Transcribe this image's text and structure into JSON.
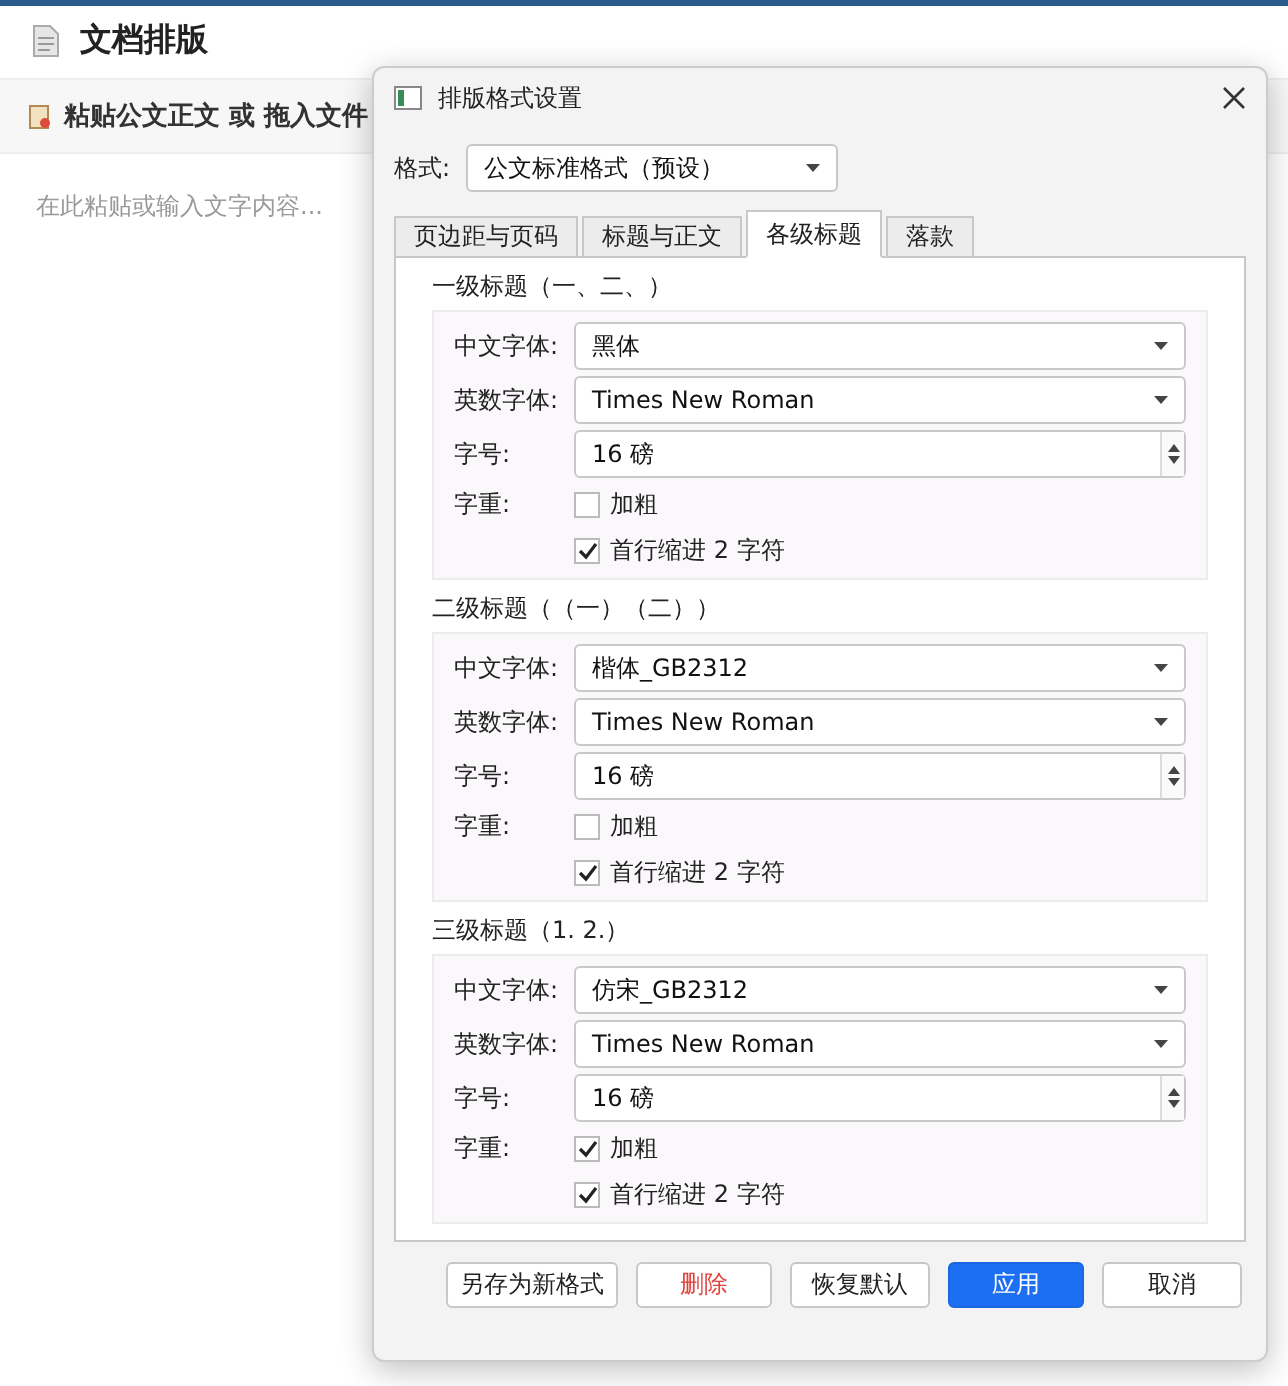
{
  "app": {
    "title": "文档排版",
    "toolbar_label": "粘贴公文正文 或 拖入文件",
    "editor": {
      "placeholder": "在此粘贴或输入文字内容..."
    }
  },
  "dialog": {
    "title": "排版格式设置",
    "format": {
      "label": "格式:",
      "value": "公文标准格式（预设）"
    },
    "tabs": [
      {
        "label": "页边距与页码",
        "selected": false
      },
      {
        "label": "标题与正文",
        "selected": false
      },
      {
        "label": "各级标题",
        "selected": true
      },
      {
        "label": "落款",
        "selected": false
      }
    ],
    "sections": [
      {
        "heading": "一级标题（一、二、）",
        "chinese_font": {
          "label": "中文字体:",
          "value": "黑体"
        },
        "english_font": {
          "label": "英数字体:",
          "value": "Times New Roman"
        },
        "size": {
          "label": "字号:",
          "value": "16 磅"
        },
        "weight_label": "字重:",
        "bold": {
          "label": "加粗",
          "checked": false
        },
        "indent": {
          "label": "首行缩进 2 字符",
          "checked": true
        }
      },
      {
        "heading": "二级标题（（一）（二））",
        "chinese_font": {
          "label": "中文字体:",
          "value": "楷体_GB2312"
        },
        "english_font": {
          "label": "英数字体:",
          "value": "Times New Roman"
        },
        "size": {
          "label": "字号:",
          "value": "16 磅"
        },
        "weight_label": "字重:",
        "bold": {
          "label": "加粗",
          "checked": false
        },
        "indent": {
          "label": "首行缩进 2 字符",
          "checked": true
        }
      },
      {
        "heading": "三级标题（1. 2.）",
        "chinese_font": {
          "label": "中文字体:",
          "value": "仿宋_GB2312"
        },
        "english_font": {
          "label": "英数字体:",
          "value": "Times New Roman"
        },
        "size": {
          "label": "字号:",
          "value": "16 磅"
        },
        "weight_label": "字重:",
        "bold": {
          "label": "加粗",
          "checked": true
        },
        "indent": {
          "label": "首行缩进 2 字符",
          "checked": true
        }
      }
    ],
    "buttons": [
      {
        "label": "另存为新格式",
        "kind": "normal"
      },
      {
        "label": "删除",
        "kind": "danger"
      },
      {
        "label": "恢复默认",
        "kind": "normal"
      },
      {
        "label": "应用",
        "kind": "primary"
      },
      {
        "label": "取消",
        "kind": "normal"
      }
    ]
  }
}
